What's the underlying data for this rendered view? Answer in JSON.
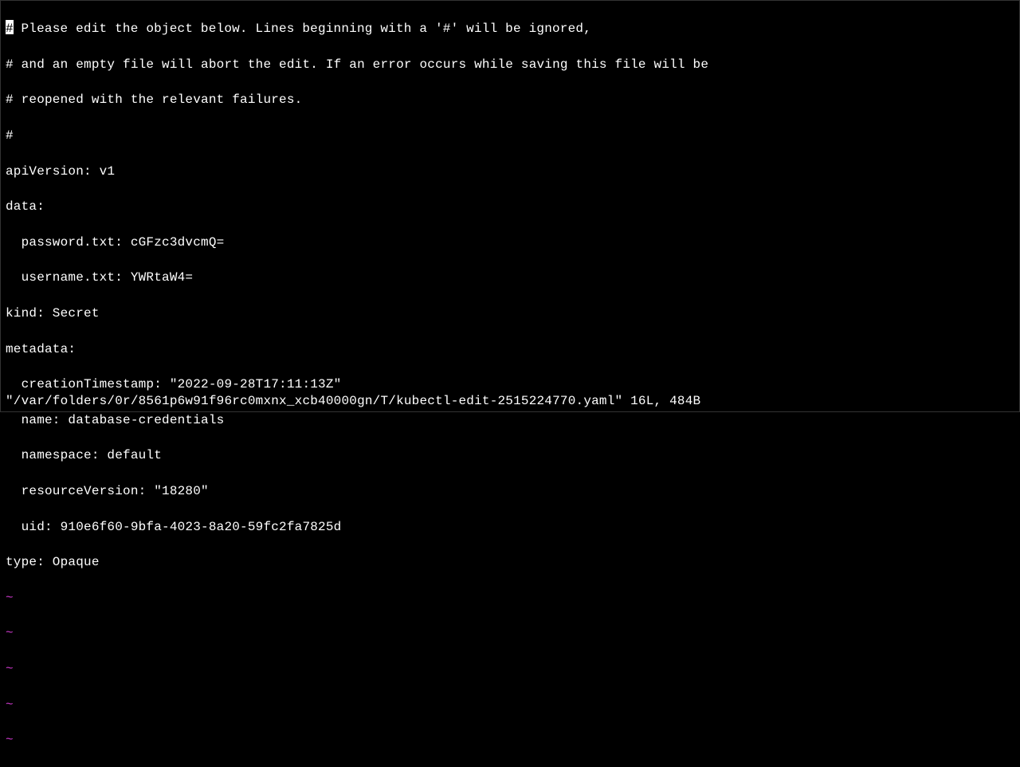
{
  "editor": {
    "comment_lines": [
      "# Please edit the object below. Lines beginning with a '#' will be ignored,",
      "# and an empty file will abort the edit. If an error occurs while saving this file will be",
      "# reopened with the relevant failures.",
      "#"
    ],
    "yaml": {
      "apiVersion_line": "apiVersion: v1",
      "data_line": "data:",
      "password_line": "  password.txt: cGFzc3dvcmQ=",
      "username_line": "  username.txt: YWRtaW4=",
      "kind_line": "kind: Secret",
      "metadata_line": "metadata:",
      "creationTimestamp_line": "  creationTimestamp: \"2022-09-28T17:11:13Z\"",
      "name_line": "  name: database-credentials",
      "namespace_line": "  namespace: default",
      "resourceVersion_line": "  resourceVersion: \"18280\"",
      "uid_line": "  uid: 910e6f60-9bfa-4023-8a20-59fc2fa7825d",
      "type_line": "type: Opaque"
    },
    "tilde": "~",
    "cursor_char": "#",
    "cursor_rest": " Please edit the object below. Lines beginning with a '#' will be ignored,"
  },
  "status": {
    "text": "\"/var/folders/0r/8561p6w91f96rc0mxnx_xcb40000gn/T/kubectl-edit-2515224770.yaml\" 16L, 484B"
  }
}
